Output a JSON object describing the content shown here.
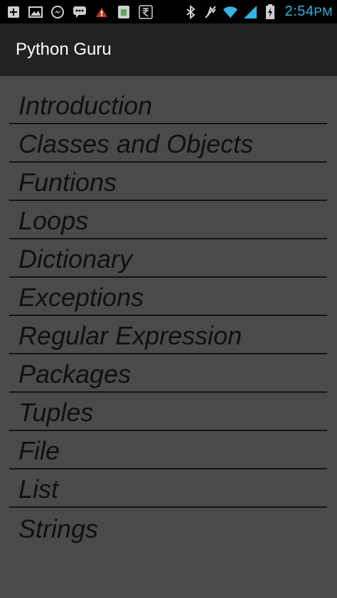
{
  "status_bar": {
    "time": "2:54",
    "time_suffix": "PM",
    "left_icons": [
      "plus-box-icon",
      "image-icon",
      "messenger-icon",
      "chat-bubble-icon",
      "drain-warning-icon",
      "sim-card-icon",
      "rupee-icon"
    ],
    "right_icons": [
      "bluetooth-icon",
      "vibrate-off-icon",
      "wifi-icon",
      "signal-icon",
      "battery-charging-icon"
    ],
    "accent_color": "#33b5e5"
  },
  "action_bar": {
    "title": "Python Guru"
  },
  "topics": [
    {
      "label": "Introduction"
    },
    {
      "label": "Classes and Objects"
    },
    {
      "label": "Funtions"
    },
    {
      "label": "Loops"
    },
    {
      "label": "Dictionary"
    },
    {
      "label": "Exceptions"
    },
    {
      "label": "Regular Expression"
    },
    {
      "label": "Packages"
    },
    {
      "label": "Tuples"
    },
    {
      "label": "File"
    },
    {
      "label": "List"
    },
    {
      "label": "Strings"
    }
  ],
  "colors": {
    "background": "#4a4a4a",
    "action_bar": "#222222",
    "divider": "#141414",
    "topic_text": "#101010"
  }
}
